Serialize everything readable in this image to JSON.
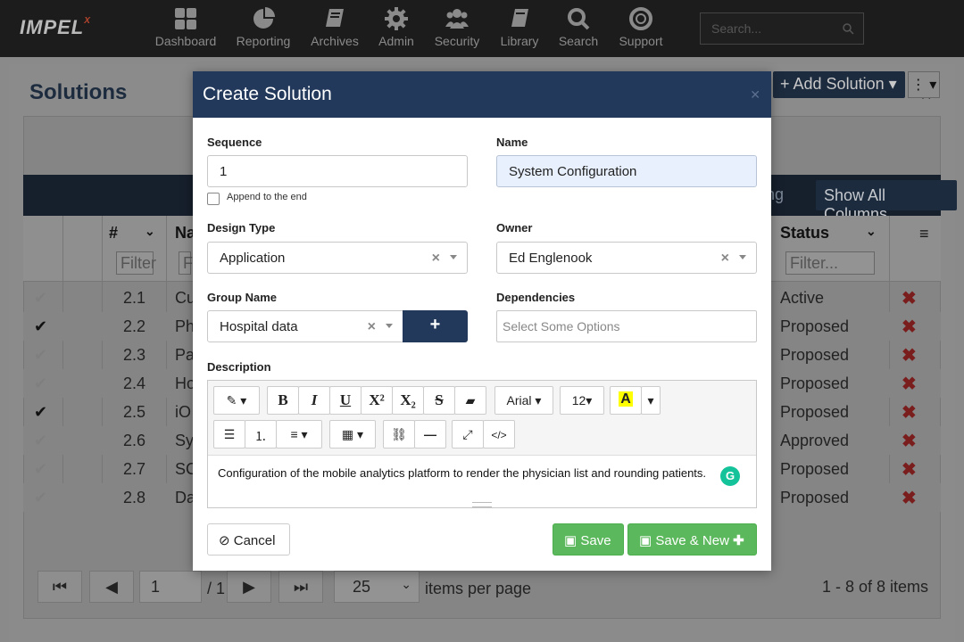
{
  "app": {
    "logo": "IMPEL",
    "logo_mark": "X"
  },
  "nav": {
    "items": [
      {
        "label": "Dashboard",
        "icon": "dashboard-icon"
      },
      {
        "label": "Reporting",
        "icon": "pie-chart-icon"
      },
      {
        "label": "Archives",
        "icon": "book-icon"
      },
      {
        "label": "Admin",
        "icon": "gear-icon"
      },
      {
        "label": "Security",
        "icon": "users-icon"
      },
      {
        "label": "Library",
        "icon": "library-icon"
      },
      {
        "label": "Search",
        "icon": "search-icon"
      },
      {
        "label": "Support",
        "icon": "life-ring-icon"
      }
    ],
    "search_placeholder": "Search..."
  },
  "page": {
    "title": "Solutions",
    "add_button": "+ Add Solution",
    "group_hint": "ng",
    "show_all_columns": "Show All Columns",
    "columns": {
      "num": "#",
      "name": "Na",
      "status": "Status"
    },
    "filters": {
      "num": "Filter",
      "name": "Fi",
      "status": "Filter..."
    },
    "rows": [
      {
        "checked": false,
        "num": "2.1",
        "name": "Cu",
        "status": "Active"
      },
      {
        "checked": true,
        "num": "2.2",
        "name": "Ph",
        "status": "Proposed"
      },
      {
        "checked": false,
        "num": "2.3",
        "name": "Pa",
        "status": "Proposed"
      },
      {
        "checked": false,
        "num": "2.4",
        "name": "Ho",
        "status": "Proposed"
      },
      {
        "checked": true,
        "num": "2.5",
        "name": "iO",
        "status": "Proposed"
      },
      {
        "checked": false,
        "num": "2.6",
        "name": "Sy",
        "status": "Approved"
      },
      {
        "checked": false,
        "num": "2.7",
        "name": "SC",
        "status": "Proposed"
      },
      {
        "checked": false,
        "num": "2.8",
        "name": "Da",
        "status": "Proposed"
      }
    ],
    "pager": {
      "page": "1",
      "of": "/ 1",
      "page_size": "25",
      "items_per_page": "items per page",
      "count": "1 - 8 of 8 items"
    }
  },
  "modal": {
    "title": "Create Solution",
    "sequence": {
      "label": "Sequence",
      "value": "1",
      "append_label": "Append to the end"
    },
    "name": {
      "label": "Name",
      "value": "System Configuration"
    },
    "design_type": {
      "label": "Design Type",
      "value": "Application"
    },
    "owner": {
      "label": "Owner",
      "value": "Ed Englenook"
    },
    "group_name": {
      "label": "Group Name",
      "value": "Hospital data",
      "add": "+"
    },
    "dependencies": {
      "label": "Dependencies",
      "placeholder": "Select Some Options"
    },
    "description": {
      "label": "Description",
      "font": "Arial",
      "size": "12",
      "text": "Configuration of the mobile analytics platform to render the physician list and rounding patients."
    },
    "buttons": {
      "cancel": "Cancel",
      "save": "Save",
      "save_new": "Save & New"
    }
  },
  "colors": {
    "navy": "#23395b",
    "green": "#5cb85c",
    "delete_red": "#7a1d1d"
  }
}
